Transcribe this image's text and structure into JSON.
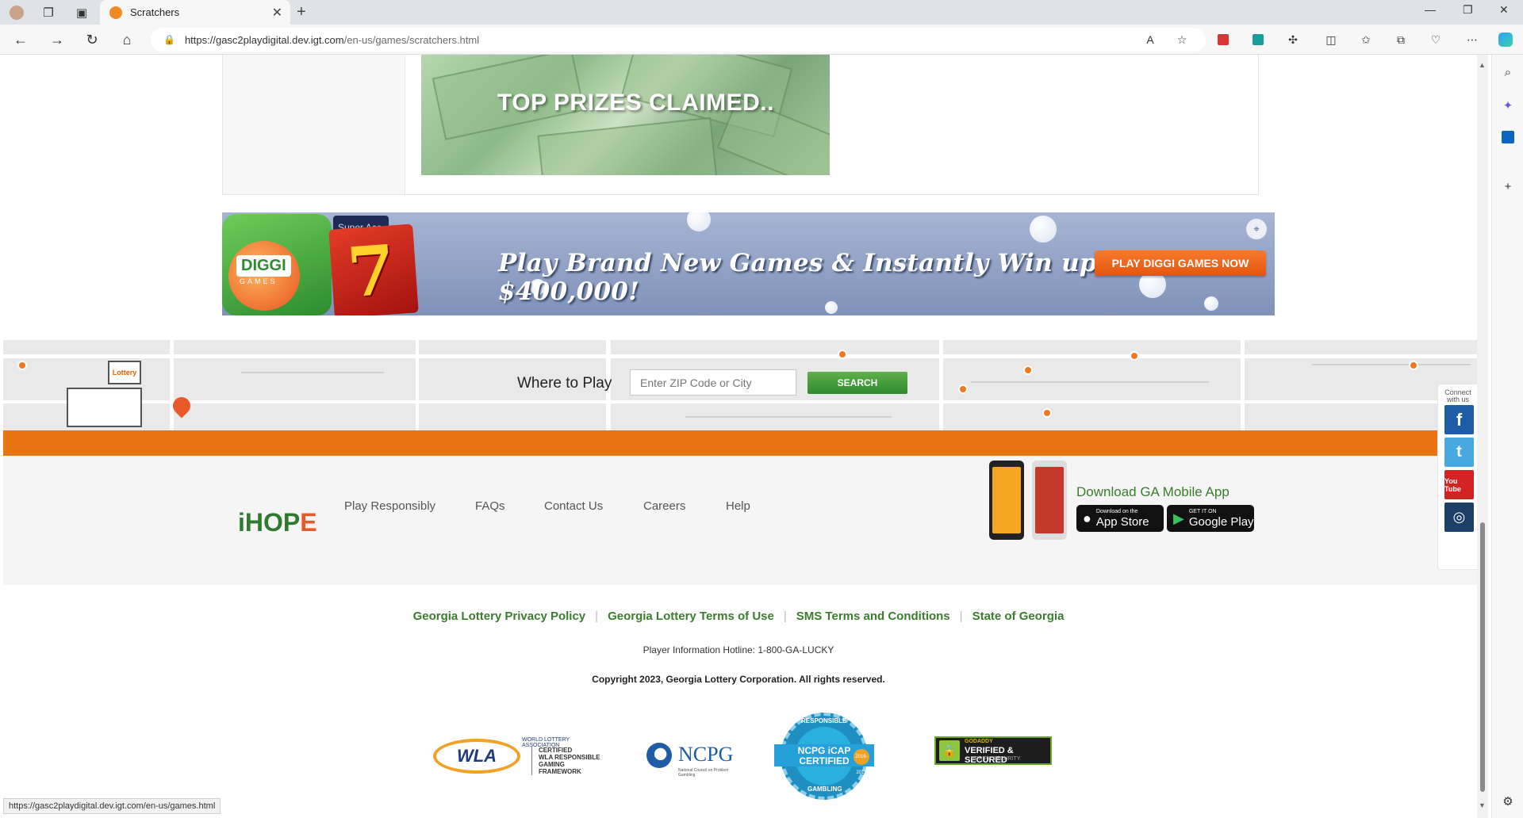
{
  "browser": {
    "tab_title": "Scratchers",
    "url_host": "https://gasc2playdigital.dev.igt.com",
    "url_path": "/en-us/games/scratchers.html",
    "status_url": "https://gasc2playdigital.dev.igt.com/en-us/games.html"
  },
  "promo": {
    "top_prizes_text": "TOP PRIZES CLAIMED.."
  },
  "banner": {
    "logo_text": "DIGGI",
    "logo_sub": "GAMES",
    "card_text": "Super Ace",
    "headline": "Play Brand New Games & Instantly Win up to $400,000!",
    "cta_label": "PLAY DIGGI GAMES NOW"
  },
  "where_to_play": {
    "label": "Where to Play",
    "placeholder": "Enter ZIP Code or City",
    "search_label": "SEARCH",
    "store_sign": "Lottery"
  },
  "footer": {
    "ihope_prefix": "iHOP",
    "ihope_suffix": "E",
    "links": [
      "Play Responsibly",
      "FAQs",
      "Contact Us",
      "Careers",
      "Help"
    ],
    "download_title": "Download GA Mobile App",
    "app_store_small": "Download on the",
    "app_store_label": "App Store",
    "google_play_small": "GET IT ON",
    "google_play_label": "Google Play",
    "legal_links": [
      "Georgia Lottery Privacy Policy",
      "Georgia Lottery Terms of Use",
      "SMS Terms and Conditions",
      "State of Georgia"
    ],
    "hotline": "Player Information Hotline: 1-800-GA-LUCKY",
    "copyright": "Copyright 2023, Georgia Lottery Corporation. All rights reserved."
  },
  "social": {
    "label": "Connect with us",
    "items": [
      {
        "name": "facebook",
        "glyph": "f",
        "color": "#1f5ca8"
      },
      {
        "name": "twitter",
        "glyph": "t",
        "color": "#4aa8e0"
      },
      {
        "name": "youtube",
        "glyph": "You Tube",
        "color": "#d32323"
      },
      {
        "name": "instagram",
        "glyph": "◎",
        "color": "#1d3e66"
      }
    ]
  },
  "badges": {
    "wla_top": "WORLD LOTTERY ASSOCIATION",
    "wla_text": "WLA",
    "wla_cert": "CERTIFIED\nWLA RESPONSIBLE GAMING\nFRAMEWORK",
    "ncpg_text": "NCPG",
    "ncpg_sub": "National Council on Problem Gambling",
    "icap_top": "RESPONSIBLE",
    "icap_band": "NCPG iCAP CERTIFIED",
    "icap_bottom": "GAMBLING",
    "icap_years": "2016-2017",
    "godaddy_top": "GODADDY",
    "godaddy_main": "VERIFIED & SECURED",
    "godaddy_sub": "VERIFY SECURITY"
  },
  "colors": {
    "brand_green": "#3a7d2d",
    "brand_orange": "#e87511"
  }
}
